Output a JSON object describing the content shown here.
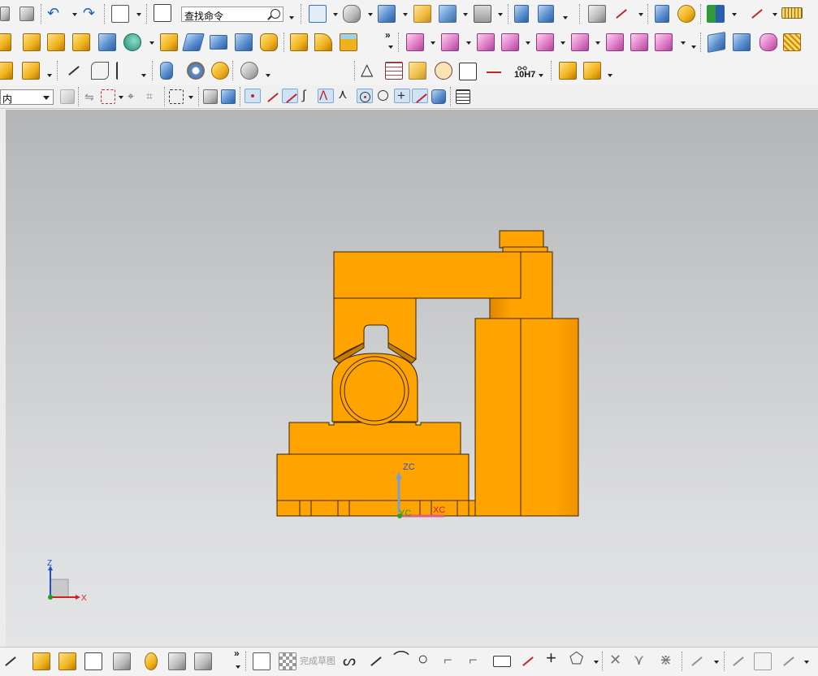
{
  "toolbar": {
    "search_placeholder": "查找命令",
    "selection_filter": "内",
    "tolerance_label": "10H7",
    "more_glyph": "»"
  },
  "bottom_toolbar": {
    "finish_sketch_label": "完成草图",
    "more_glyph": "»"
  },
  "viewport": {
    "datum_labels": {
      "zc": "ZC",
      "yc": "YC",
      "xc": "XC"
    },
    "triad_labels": {
      "z": "Z",
      "x": "X"
    }
  },
  "colors": {
    "part_orange": "#ffa300",
    "part_edge": "#3a2500",
    "viewport_top": "#b3b5b7",
    "viewport_bottom": "#e3e4e6",
    "axis_z": "#1f4fd0",
    "axis_x": "#d02020",
    "axis_y": "#20a020"
  },
  "icons": [
    "new-file-icon",
    "paste-icon",
    "undo-icon",
    "redo-icon",
    "wcs-icon",
    "information-icon",
    "search-icon",
    "fit-view-icon",
    "shaded-view-icon",
    "view-cube-icon",
    "section-icon",
    "background-icon",
    "move-icon",
    "layer-icon",
    "analysis-icon",
    "render-icon",
    "measure-icon",
    "extrude-icon",
    "hole-icon",
    "pattern-icon",
    "boolean-icon",
    "edge-blend-icon",
    "surface-icon",
    "assembly-icon",
    "dimension-icon",
    "note-icon",
    "weld-icon"
  ]
}
